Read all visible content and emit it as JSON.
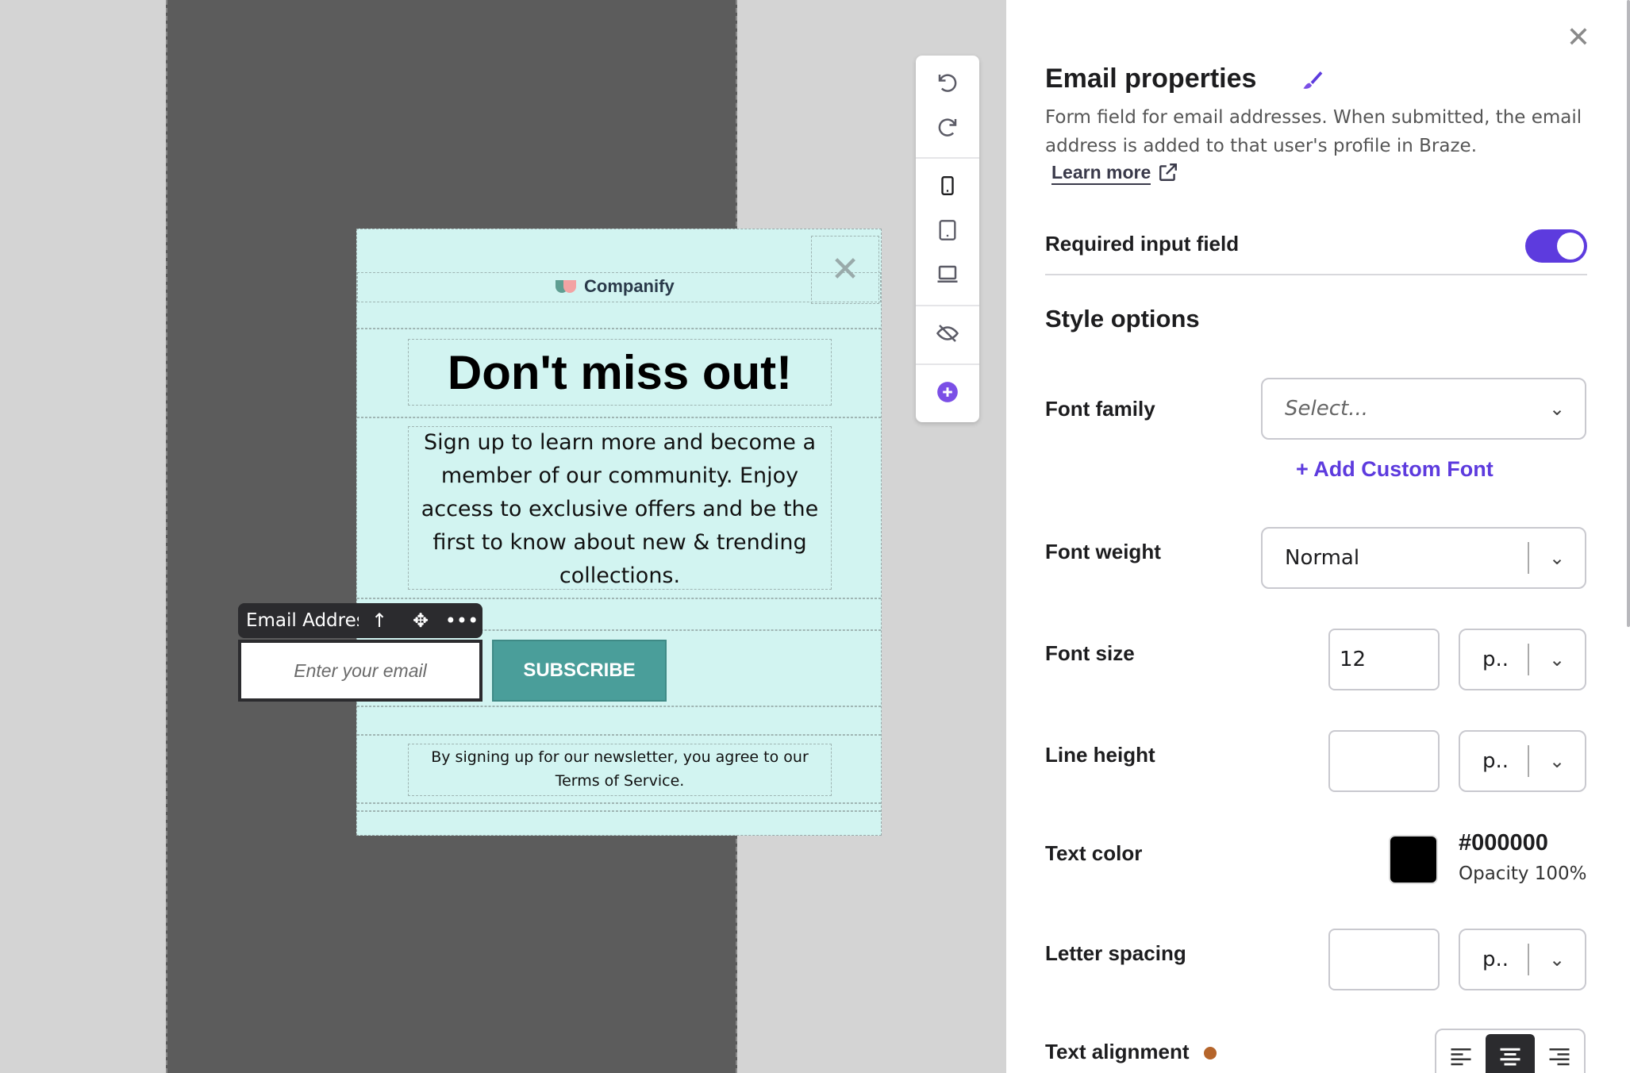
{
  "form": {
    "brand": "Companify",
    "headline": "Don't miss out!",
    "body": "Sign up to learn more and become a member of our community. Enjoy access to exclusive offers and be the first to know about new & trending collections.",
    "email_label": "Email Addres",
    "email_placeholder": "Enter your email",
    "subscribe_label": "SUBSCRIBE",
    "terms": "By signing up for our newsletter, you agree to our Terms of Service."
  },
  "rail": {
    "icons": [
      "undo-icon",
      "redo-icon",
      "mobile-icon",
      "tablet-icon",
      "desktop-icon",
      "hide-icon",
      "add-icon"
    ]
  },
  "panel": {
    "title": "Email properties",
    "description": "Form field for email addresses. When submitted, the email address is added to that user's profile in Braze.",
    "learn_more": "Learn more",
    "required_label": "Required input field",
    "required_on": true,
    "style_heading": "Style options",
    "font_family_label": "Font family",
    "font_family_placeholder": "Select...",
    "add_custom_font": "+ Add Custom Font",
    "font_weight_label": "Font weight",
    "font_weight_value": "Normal",
    "font_size_label": "Font size",
    "font_size_value": "12",
    "font_size_unit": "p..",
    "line_height_label": "Line height",
    "line_height_value": "",
    "line_height_unit": "p..",
    "text_color_label": "Text color",
    "text_color_hex": "#000000",
    "text_color_opacity": "Opacity 100%",
    "letter_spacing_label": "Letter spacing",
    "letter_spacing_value": "",
    "letter_spacing_unit": "p..",
    "text_alignment_label": "Text alignment"
  },
  "colors": {
    "accent": "#5d3bde",
    "form_bg": "#d2f4f1",
    "subscribe_bg": "#4a9e9a",
    "text_color": "#000000"
  }
}
